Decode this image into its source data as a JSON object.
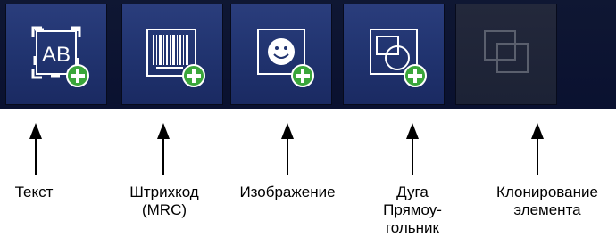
{
  "toolbar": {
    "buttons": [
      {
        "name": "add-text-button",
        "icon": "text-ab-add-icon",
        "enabled": true
      },
      {
        "name": "add-barcode-button",
        "icon": "barcode-add-icon",
        "enabled": true
      },
      {
        "name": "add-image-button",
        "icon": "smiley-image-add-icon",
        "enabled": true
      },
      {
        "name": "add-shape-button",
        "icon": "shapes-add-icon",
        "enabled": true
      },
      {
        "name": "clone-element-button",
        "icon": "clone-icon",
        "enabled": false
      }
    ]
  },
  "callouts": {
    "text": "Текст",
    "barcode": "Штрихкод\n(MRC)",
    "image": "Изображение",
    "shape": "Дуга\nПрямоу-\nгольник",
    "clone": "Клонирование\nэлемента"
  },
  "colors": {
    "toolbar_bg": "#0f1733",
    "button_face": "#213470",
    "add_badge": "#3aa63a",
    "disabled_icon": "#5a5f6d"
  }
}
